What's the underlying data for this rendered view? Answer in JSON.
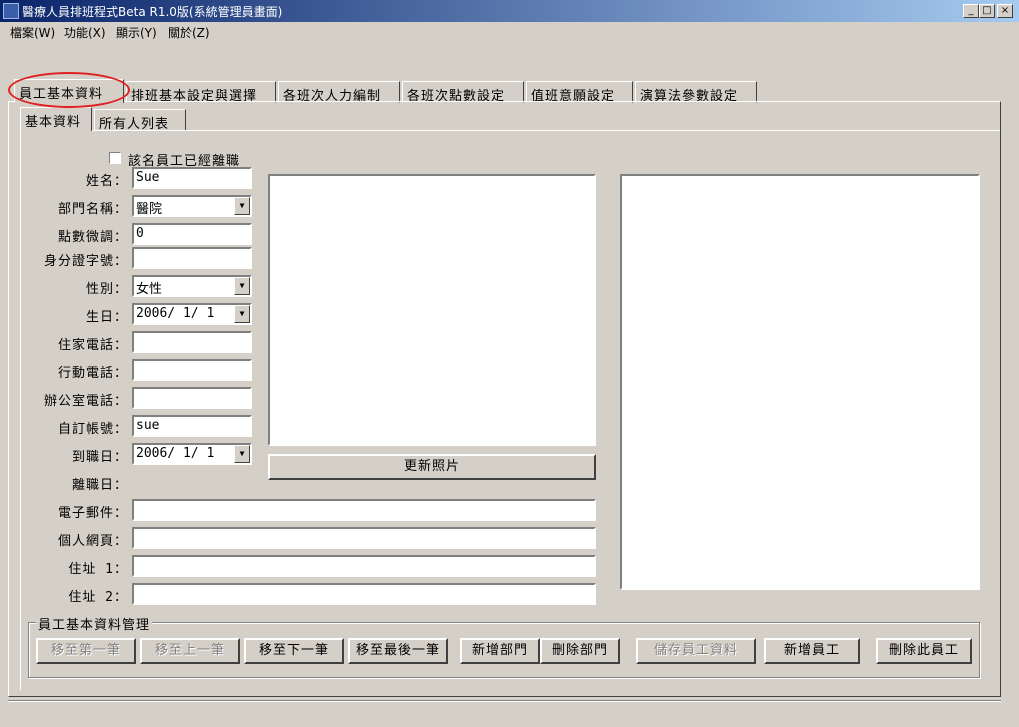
{
  "window": {
    "title": "醫療人員排班程式Beta R1.0版(系統管理員畫面)",
    "minimize_glyph": "_",
    "maximize_glyph": "□",
    "close_glyph": "×"
  },
  "menu": [
    "檔案(W)",
    "功能(X)",
    "顯示(Y)",
    "關於(Z)"
  ],
  "tabs": [
    "員工基本資料",
    "排班基本設定與選擇",
    "各班次人力編制",
    "各班次點數設定",
    "值班意願設定",
    "演算法參數設定"
  ],
  "subtabs": [
    "基本資料",
    "所有人列表"
  ],
  "form": {
    "resigned_label": "該名員工已經離職",
    "name_label": "姓名：",
    "name_value": "Sue",
    "dept_label": "部門名稱：",
    "dept_value": "醫院",
    "points_label": "點數微調：",
    "points_value": "0",
    "id_label": "身分證字號：",
    "id_value": "",
    "gender_label": "性別：",
    "gender_value": "女性",
    "birthday_label": "生日：",
    "birthday_value": "2006/ 1/ 1",
    "home_phone_label": "住家電話：",
    "home_phone_value": "",
    "mobile_label": "行動電話：",
    "mobile_value": "",
    "office_phone_label": "辦公室電話：",
    "office_phone_value": "",
    "account_label": "自訂帳號：",
    "account_value": "sue",
    "hire_date_label": "到職日：",
    "hire_date_value": "2006/ 1/ 1",
    "leave_date_label": "離職日：",
    "email_label": "電子郵件：",
    "email_value": "",
    "homepage_label": "個人網頁：",
    "homepage_value": "",
    "address1_label": "住址 1：",
    "address1_value": "",
    "address2_label": "住址 2：",
    "address2_value": "",
    "update_photo_button": "更新照片"
  },
  "management": {
    "group_label": "員工基本資料管理",
    "first": "移至第一筆",
    "prev": "移至上一筆",
    "next": "移至下一筆",
    "last": "移至最後一筆",
    "add_dept": "新增部門",
    "delete_dept": "刪除部門",
    "save": "儲存員工資料",
    "add_employee": "新增員工",
    "delete_employee": "刪除此員工"
  },
  "colors": {
    "highlight_circle": "#e02020",
    "titlebar": "#0a246a"
  }
}
